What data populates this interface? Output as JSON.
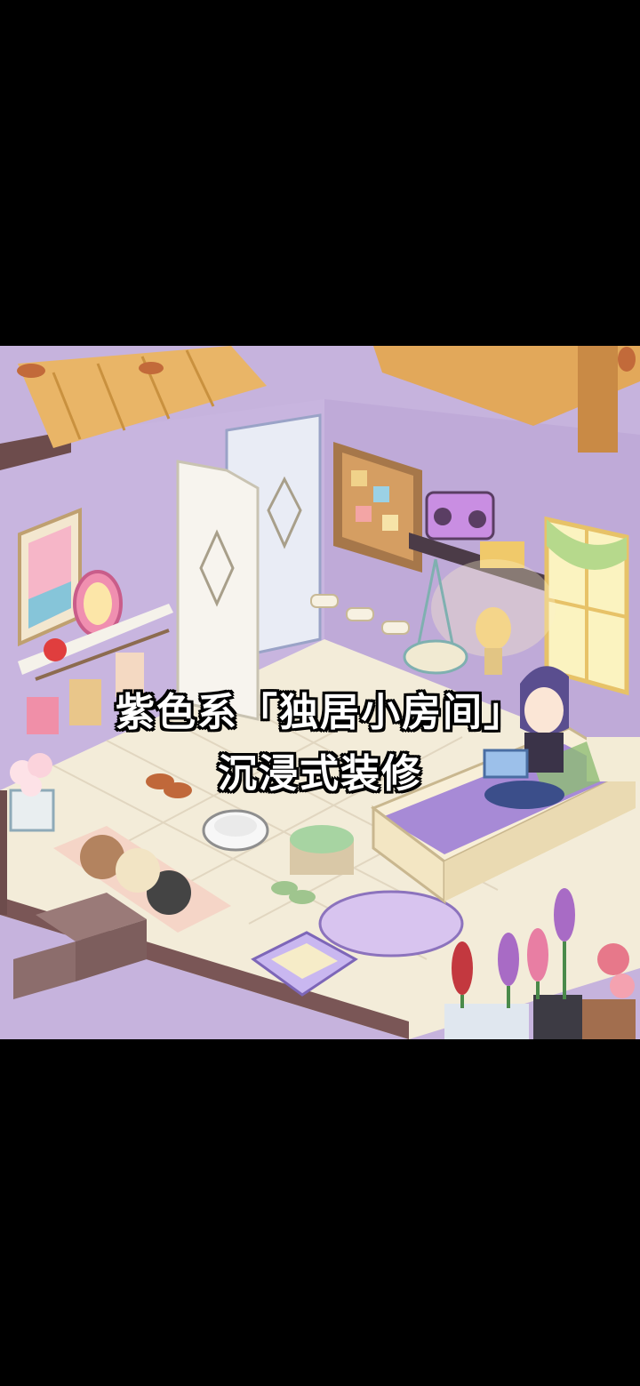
{
  "video": {
    "caption_line1": "紫色系「独居小房间」",
    "caption_line2": "沉浸式装修"
  },
  "scene": {
    "style": "isometric pixel-art bedroom",
    "colors": {
      "wall": "#c6b3dd",
      "floor": "#f3ecd9",
      "roof": "#e9b567",
      "bed_cover": "#a88ad6",
      "frame": "#6d4c4c",
      "background": "#000000"
    }
  }
}
